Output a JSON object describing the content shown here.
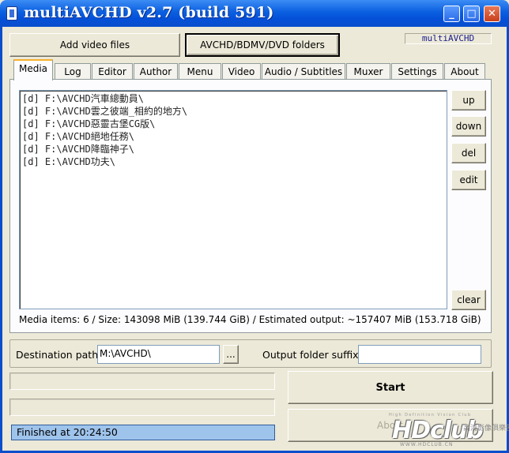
{
  "window": {
    "title": "multiAVCHD v2.7 (build 591)",
    "controls": {
      "minimize": "_",
      "maximize": "□",
      "close": "✕"
    }
  },
  "toolbar": {
    "add_video_files": "Add video files",
    "avchd_folders": "AVCHD/BDMV/DVD folders",
    "version_label": "multiAVCHD"
  },
  "tabs": [
    "Media",
    "Log",
    "Editor",
    "Author",
    "Menu",
    "Video",
    "Audio / Subtitles",
    "Muxer",
    "Settings",
    "About"
  ],
  "active_tab": "Media",
  "media": {
    "items": [
      "[d] F:\\AVCHD汽車總動員\\",
      "[d] F:\\AVCHD雲之彼端_相約的地方\\",
      "[d] F:\\AVCHD惡靈古堡CG版\\",
      "[d] F:\\AVCHD絕地任務\\",
      "[d] F:\\AVCHD降臨神子\\",
      "[d] E:\\AVCHD功夫\\"
    ],
    "buttons": {
      "up": "up",
      "down": "down",
      "del": "del",
      "edit": "edit",
      "clear": "clear"
    },
    "status": "Media items: 6 / Size: 143098 MiB (139.744 GiB) / Estimated output: ~157407 MiB (153.718 GiB)"
  },
  "destination": {
    "label": "Destination path:",
    "value": "M:\\AVCHD\\",
    "browse": "...",
    "suffix_label": "Output folder suffix:",
    "suffix_value": ""
  },
  "actions": {
    "start": "Start",
    "abort": "Abort"
  },
  "status_bar": "Finished at 20:24:50",
  "watermark": {
    "logo": "HDclub",
    "tagline": "High Definition Vision Club",
    "chinese": "高清影像俱樂部",
    "url": "WWW.HDCLUB.CN"
  },
  "colors": {
    "titlebar": "#0A5FE0",
    "status_fill": "#9FC4EC",
    "tab_highlight": "#F7B02E"
  }
}
